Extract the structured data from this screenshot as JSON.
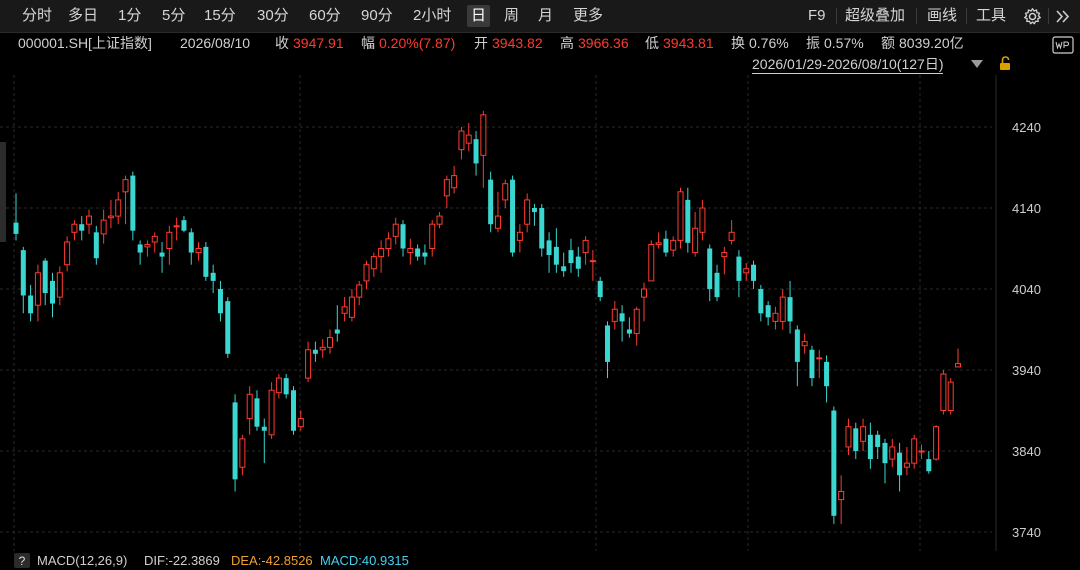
{
  "toolbar": {
    "tabs": [
      "分时",
      "多日",
      "1分",
      "5分",
      "15分",
      "30分",
      "60分",
      "90分",
      "2小时",
      "日",
      "周",
      "月",
      "更多"
    ],
    "active_tab": "日",
    "right": {
      "f9": "F9",
      "overlay": "超级叠加",
      "draw": "画线",
      "tools": "工具"
    }
  },
  "quote": {
    "code": "000001.SH[上证指数]",
    "date": "2026/08/10",
    "close_label": "收",
    "close": "3947.91",
    "change_label": "幅",
    "change": "0.20%(7.87)",
    "open_label": "开",
    "open": "3943.82",
    "high_label": "高",
    "high": "3966.36",
    "low_label": "低",
    "low": "3943.81",
    "turnover_label": "换",
    "turnover": "0.76%",
    "amplitude_label": "振",
    "amplitude": "0.57%",
    "amount_label": "额",
    "amount": "8039.20亿"
  },
  "range_label": "2026/01/29-2026/08/10(127日)",
  "indicator": {
    "help": "?",
    "name": "MACD(12,26,9)",
    "dif": "DIF:-22.3869",
    "dea": "DEA:-42.8526",
    "macd": "MACD:40.9315"
  },
  "colors": {
    "up": "#ff3b30",
    "down": "#3ad6d0",
    "grid": "#2a2a2a",
    "background": "#000000"
  },
  "chart_data": {
    "type": "candlestick",
    "y_ticks": [
      4240,
      4140,
      4040,
      3940,
      3840,
      3740
    ],
    "ylim": [
      3720,
      4270
    ],
    "candles": [
      [
        4122,
        4108,
        4158,
        4100
      ],
      [
        4088,
        4032,
        4092,
        4010
      ],
      [
        4032,
        4010,
        4045,
        4000
      ],
      [
        4020,
        4060,
        4070,
        4000
      ],
      [
        4075,
        4035,
        4078,
        4020
      ],
      [
        4050,
        4022,
        4060,
        4005
      ],
      [
        4030,
        4060,
        4068,
        4020
      ],
      [
        4070,
        4098,
        4105,
        4062
      ],
      [
        4110,
        4120,
        4125,
        4100
      ],
      [
        4120,
        4112,
        4130,
        4100
      ],
      [
        4120,
        4130,
        4138,
        4108
      ],
      [
        4110,
        4078,
        4118,
        4070
      ],
      [
        4108,
        4125,
        4138,
        4096
      ],
      [
        4128,
        4130,
        4150,
        4115
      ],
      [
        4130,
        4150,
        4160,
        4120
      ],
      [
        4160,
        4175,
        4180,
        4120
      ],
      [
        4180,
        4112,
        4185,
        4100
      ],
      [
        4095,
        4085,
        4100,
        4070
      ],
      [
        4092,
        4095,
        4100,
        4080
      ],
      [
        4098,
        4105,
        4110,
        4085
      ],
      [
        4085,
        4080,
        4098,
        4060
      ],
      [
        4090,
        4110,
        4118,
        4070
      ],
      [
        4118,
        4118,
        4128,
        4100
      ],
      [
        4125,
        4112,
        4130,
        4110
      ],
      [
        4110,
        4085,
        4115,
        4070
      ],
      [
        4085,
        4090,
        4098,
        4075
      ],
      [
        4092,
        4055,
        4098,
        4050
      ],
      [
        4060,
        4050,
        4070,
        4035
      ],
      [
        4040,
        4010,
        4050,
        4000
      ],
      [
        4025,
        3960,
        4030,
        3955
      ],
      [
        3900,
        3805,
        3910,
        3790
      ],
      [
        3820,
        3855,
        3860,
        3810
      ],
      [
        3880,
        3910,
        3920,
        3860
      ],
      [
        3905,
        3870,
        3915,
        3865
      ],
      [
        3870,
        3865,
        3880,
        3825
      ],
      [
        3860,
        3915,
        3925,
        3855
      ],
      [
        3912,
        3930,
        3935,
        3905
      ],
      [
        3930,
        3910,
        3935,
        3905
      ],
      [
        3915,
        3865,
        3920,
        3860
      ],
      [
        3870,
        3880,
        3890,
        3865
      ],
      [
        3930,
        3965,
        3975,
        3925
      ],
      [
        3965,
        3960,
        3975,
        3950
      ],
      [
        3965,
        3968,
        3978,
        3955
      ],
      [
        3968,
        3980,
        3990,
        3960
      ],
      [
        3990,
        3985,
        4020,
        3975
      ],
      [
        4010,
        4018,
        4030,
        4000
      ],
      [
        4005,
        4030,
        4040,
        4000
      ],
      [
        4030,
        4045,
        4050,
        4020
      ],
      [
        4050,
        4070,
        4075,
        4040
      ],
      [
        4065,
        4080,
        4085,
        4055
      ],
      [
        4080,
        4090,
        4100,
        4060
      ],
      [
        4090,
        4102,
        4110,
        4080
      ],
      [
        4105,
        4120,
        4128,
        4095
      ],
      [
        4120,
        4090,
        4125,
        4080
      ],
      [
        4085,
        4090,
        4102,
        4070
      ],
      [
        4090,
        4080,
        4095,
        4075
      ],
      [
        4085,
        4080,
        4095,
        4070
      ],
      [
        4090,
        4120,
        4125,
        4080
      ],
      [
        4120,
        4130,
        4135,
        4115
      ],
      [
        4155,
        4175,
        4180,
        4140
      ],
      [
        4165,
        4180,
        4192,
        4158
      ],
      [
        4212,
        4235,
        4240,
        4200
      ],
      [
        4220,
        4230,
        4245,
        4210
      ],
      [
        4225,
        4195,
        4235,
        4180
      ],
      [
        4205,
        4255,
        4260,
        4165
      ],
      [
        4175,
        4120,
        4185,
        4110
      ],
      [
        4115,
        4130,
        4160,
        4110
      ],
      [
        4150,
        4170,
        4175,
        4140
      ],
      [
        4175,
        4085,
        4180,
        4080
      ],
      [
        4100,
        4110,
        4120,
        4085
      ],
      [
        4120,
        4150,
        4158,
        4110
      ],
      [
        4140,
        4135,
        4145,
        4118
      ],
      [
        4140,
        4090,
        4145,
        4080
      ],
      [
        4100,
        4082,
        4110,
        4060
      ],
      [
        4092,
        4070,
        4115,
        4060
      ],
      [
        4068,
        4062,
        4085,
        4055
      ],
      [
        4088,
        4072,
        4102,
        4060
      ],
      [
        4080,
        4065,
        4092,
        4055
      ],
      [
        4085,
        4100,
        4105,
        4070
      ],
      [
        4075,
        4075,
        4088,
        4050
      ],
      [
        4050,
        4030,
        4055,
        4025
      ],
      [
        3995,
        3950,
        4000,
        3930
      ],
      [
        4000,
        4015,
        4025,
        3990
      ],
      [
        4010,
        4000,
        4020,
        3975
      ],
      [
        3990,
        3985,
        4005,
        3980
      ],
      [
        3985,
        4015,
        4018,
        3970
      ],
      [
        4030,
        4040,
        4048,
        4000
      ],
      [
        4050,
        4095,
        4100,
        4050
      ],
      [
        4095,
        4097,
        4110,
        4090
      ],
      [
        4102,
        4085,
        4112,
        4080
      ],
      [
        4088,
        4100,
        4105,
        4080
      ],
      [
        4100,
        4160,
        4165,
        4090
      ],
      [
        4150,
        4097,
        4165,
        4085
      ],
      [
        4085,
        4115,
        4135,
        4080
      ],
      [
        4110,
        4140,
        4150,
        4100
      ],
      [
        4090,
        4040,
        4095,
        4025
      ],
      [
        4060,
        4030,
        4070,
        4025
      ],
      [
        4080,
        4085,
        4092,
        4058
      ],
      [
        4100,
        4110,
        4125,
        4095
      ],
      [
        4080,
        4050,
        4088,
        4030
      ],
      [
        4060,
        4065,
        4072,
        4050
      ],
      [
        4070,
        4050,
        4075,
        4040
      ],
      [
        4040,
        4010,
        4045,
        4000
      ],
      [
        4020,
        4005,
        4025,
        3995
      ],
      [
        4000,
        4010,
        4018,
        3990
      ],
      [
        4000,
        4030,
        4040,
        3990
      ],
      [
        4030,
        4000,
        4050,
        3985
      ],
      [
        3990,
        3950,
        3995,
        3920
      ],
      [
        3970,
        3975,
        3985,
        3960
      ],
      [
        3965,
        3930,
        3970,
        3920
      ],
      [
        3955,
        3955,
        3965,
        3930
      ],
      [
        3950,
        3920,
        3958,
        3900
      ],
      [
        3890,
        3760,
        3895,
        3750
      ],
      [
        3780,
        3790,
        3810,
        3750
      ],
      [
        3845,
        3870,
        3880,
        3835
      ],
      [
        3868,
        3840,
        3875,
        3830
      ],
      [
        3852,
        3870,
        3880,
        3840
      ],
      [
        3860,
        3830,
        3875,
        3818
      ],
      [
        3860,
        3845,
        3865,
        3830
      ],
      [
        3850,
        3825,
        3855,
        3800
      ],
      [
        3830,
        3845,
        3855,
        3820
      ],
      [
        3838,
        3810,
        3850,
        3790
      ],
      [
        3820,
        3825,
        3845,
        3810
      ],
      [
        3825,
        3855,
        3860,
        3818
      ],
      [
        3840,
        3840,
        3848,
        3830
      ],
      [
        3830,
        3815,
        3840,
        3812
      ],
      [
        3830,
        3870,
        3872,
        3828
      ],
      [
        3890,
        3935,
        3940,
        3885
      ],
      [
        3890,
        3925,
        3930,
        3885
      ],
      [
        3943.82,
        3947.91,
        3966.36,
        3943.81
      ]
    ]
  }
}
